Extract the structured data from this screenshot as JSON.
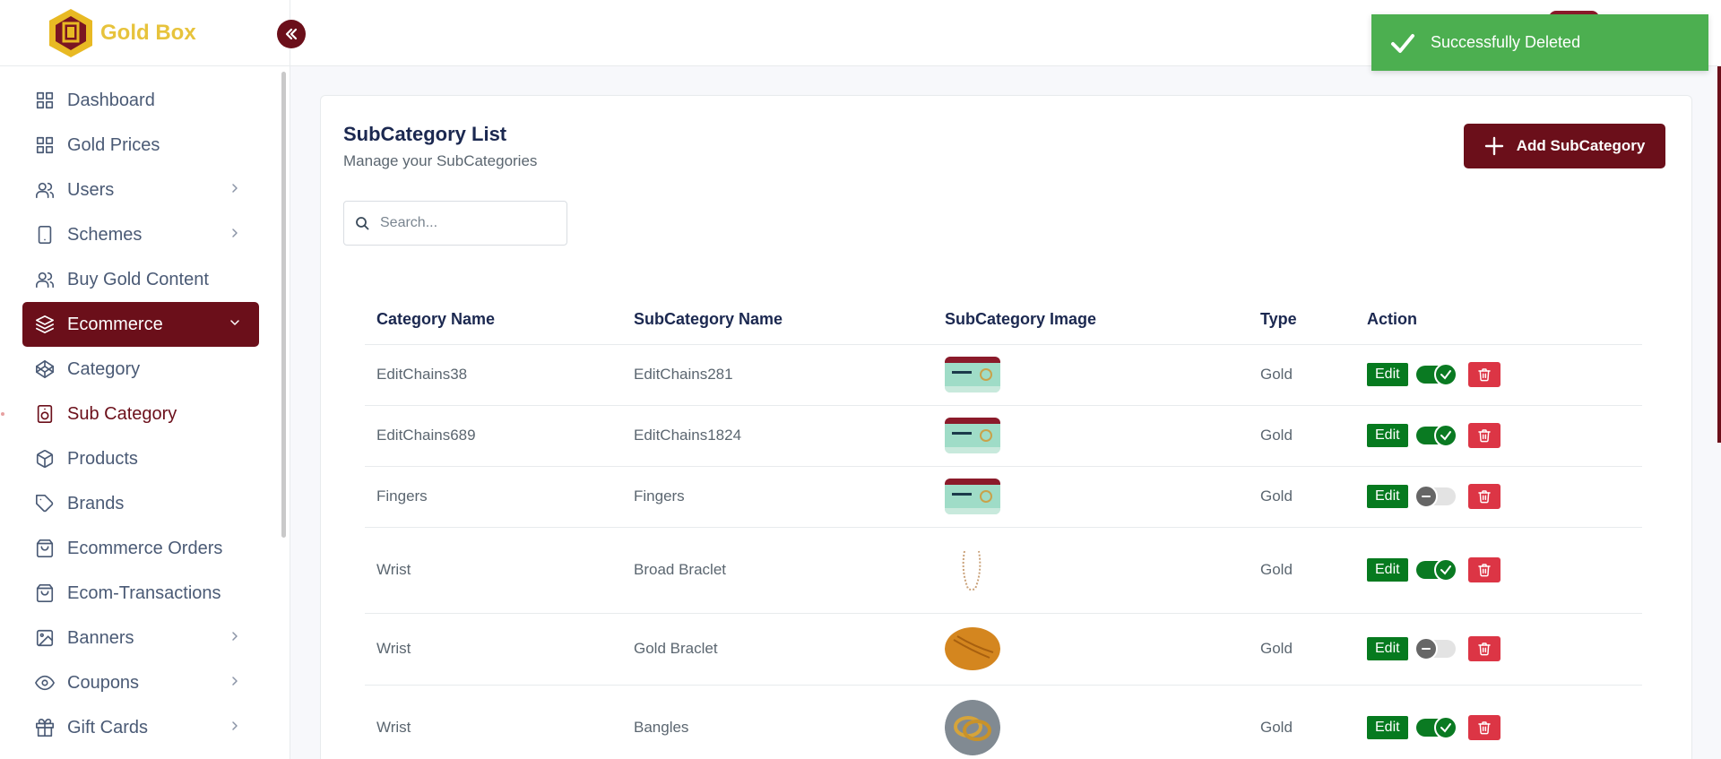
{
  "brand": {
    "name": "Gold Box"
  },
  "sidebar": {
    "items": [
      {
        "label": "Dashboard",
        "icon": "grid-icon"
      },
      {
        "label": "Gold Prices",
        "icon": "grid-icon"
      },
      {
        "label": "Users",
        "icon": "users-icon",
        "has_submenu": true
      },
      {
        "label": "Schemes",
        "icon": "tablet-icon",
        "has_submenu": true
      },
      {
        "label": "Buy Gold Content",
        "icon": "users-icon"
      },
      {
        "label": "Ecommerce",
        "icon": "layers-icon",
        "active": true,
        "expanded": true
      },
      {
        "label": "Category",
        "icon": "codepen-icon"
      },
      {
        "label": "Sub Category",
        "icon": "speaker-icon",
        "selected": true
      },
      {
        "label": "Products",
        "icon": "box-icon"
      },
      {
        "label": "Brands",
        "icon": "tag-icon"
      },
      {
        "label": "Ecommerce Orders",
        "icon": "shopping-bag-icon"
      },
      {
        "label": "Ecom-Transactions",
        "icon": "shopping-bag-icon"
      },
      {
        "label": "Banners",
        "icon": "image-icon",
        "has_submenu": true
      },
      {
        "label": "Coupons",
        "icon": "eye-icon",
        "has_submenu": true
      },
      {
        "label": "Gift Cards",
        "icon": "gift-icon",
        "has_submenu": true
      }
    ]
  },
  "toast": {
    "message": "Successfully Deleted",
    "color": "#4caf50"
  },
  "page": {
    "title": "SubCategory List",
    "subtitle": "Manage your SubCategories",
    "add_button": "Add SubCategory",
    "search_placeholder": "Search..."
  },
  "table": {
    "headers": [
      "Category Name",
      "SubCategory Name",
      "SubCategory Image",
      "Type",
      "Action"
    ],
    "edit_label": "Edit",
    "rows": [
      {
        "category": "EditChains38",
        "subcategory": "EditChains281",
        "image": "banner",
        "type": "Gold",
        "enabled": true
      },
      {
        "category": "EditChains689",
        "subcategory": "EditChains1824",
        "image": "banner",
        "type": "Gold",
        "enabled": true
      },
      {
        "category": "Fingers",
        "subcategory": "Fingers",
        "image": "banner",
        "type": "Gold",
        "enabled": false
      },
      {
        "category": "Wrist",
        "subcategory": "Broad Braclet",
        "image": "chain",
        "type": "Gold",
        "enabled": true
      },
      {
        "category": "Wrist",
        "subcategory": "Gold Braclet",
        "image": "gold",
        "type": "Gold",
        "enabled": false
      },
      {
        "category": "Wrist",
        "subcategory": "Bangles",
        "image": "bangles",
        "type": "Gold",
        "enabled": true
      }
    ]
  },
  "colors": {
    "brand": "#6b0f1a",
    "brand_text": "#e7c33c",
    "edit": "#067a1f",
    "delete": "#dc3545"
  }
}
